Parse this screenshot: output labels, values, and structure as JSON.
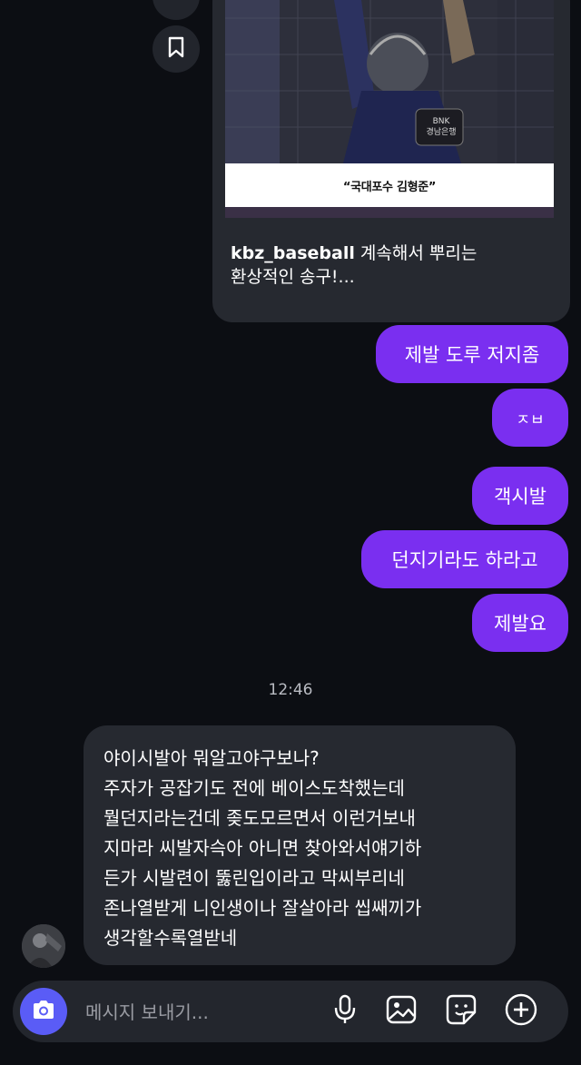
{
  "shared_post": {
    "image_caption": "“국대포수 김형준”",
    "jersey_text": "BNK\n경남은행",
    "username": "kbz_baseball",
    "text_line1": "계속해서 뿌리는",
    "text_line2": "환상적인 송구!..."
  },
  "outgoing_messages": [
    "제발 도루 저지좀",
    "ㅈㅂ",
    "객시발",
    "던지기라도 하라고",
    "제발요"
  ],
  "timestamp": "12:46",
  "incoming_message": {
    "lines": [
      "야이시발아 뭐알고야구보나?",
      "주자가 공잡기도 전에 베이스도착했는데",
      "뭘던지라는건데 좆도모르면서 이런거보내",
      "지마라 씨발자슥아 아니면 찾아와서얘기하",
      "든가 시발련이 뚫린입이라고 막씨부리네",
      "존나열받게 니인생이나 잘살아라 씹쌔끼가",
      "생각할수록열받네"
    ]
  },
  "composer": {
    "placeholder": "메시지 보내기..."
  },
  "colors": {
    "background": "#0c0e13",
    "outgoing_bubble": "#7a2ff0",
    "incoming_bubble": "#262930",
    "camera_button": "#5a5cf6"
  },
  "icons": [
    "share-icon",
    "bookmark-icon",
    "camera-icon",
    "microphone-icon",
    "gallery-icon",
    "sticker-icon",
    "plus-circle-icon"
  ]
}
